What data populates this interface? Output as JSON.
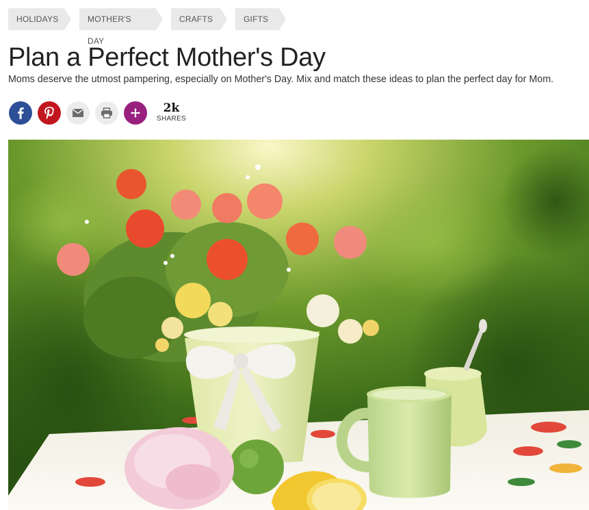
{
  "breadcrumb": {
    "items": [
      {
        "label": "HOLIDAYS"
      },
      {
        "label": "MOTHER'S DAY"
      },
      {
        "label": "CRAFTS"
      },
      {
        "label": "GIFTS"
      }
    ]
  },
  "article": {
    "title": "Plan a Perfect Mother's Day",
    "subtitle": "Moms deserve the utmost pampering, especially on Mother's Day. Mix and match these ideas to plan the perfect day for Mom."
  },
  "share": {
    "buttons": [
      {
        "icon": "facebook-icon",
        "color": "#2c4f97"
      },
      {
        "icon": "pinterest-icon",
        "color": "#c2161f"
      },
      {
        "icon": "envelope-icon",
        "color": "#ececec"
      },
      {
        "icon": "printer-icon",
        "color": "#ececec"
      },
      {
        "icon": "plus-icon",
        "color": "#98207f"
      }
    ],
    "count": "2k",
    "count_label": "SHARES"
  },
  "hero": {
    "icon": "mothers-day-flowers-photo"
  }
}
